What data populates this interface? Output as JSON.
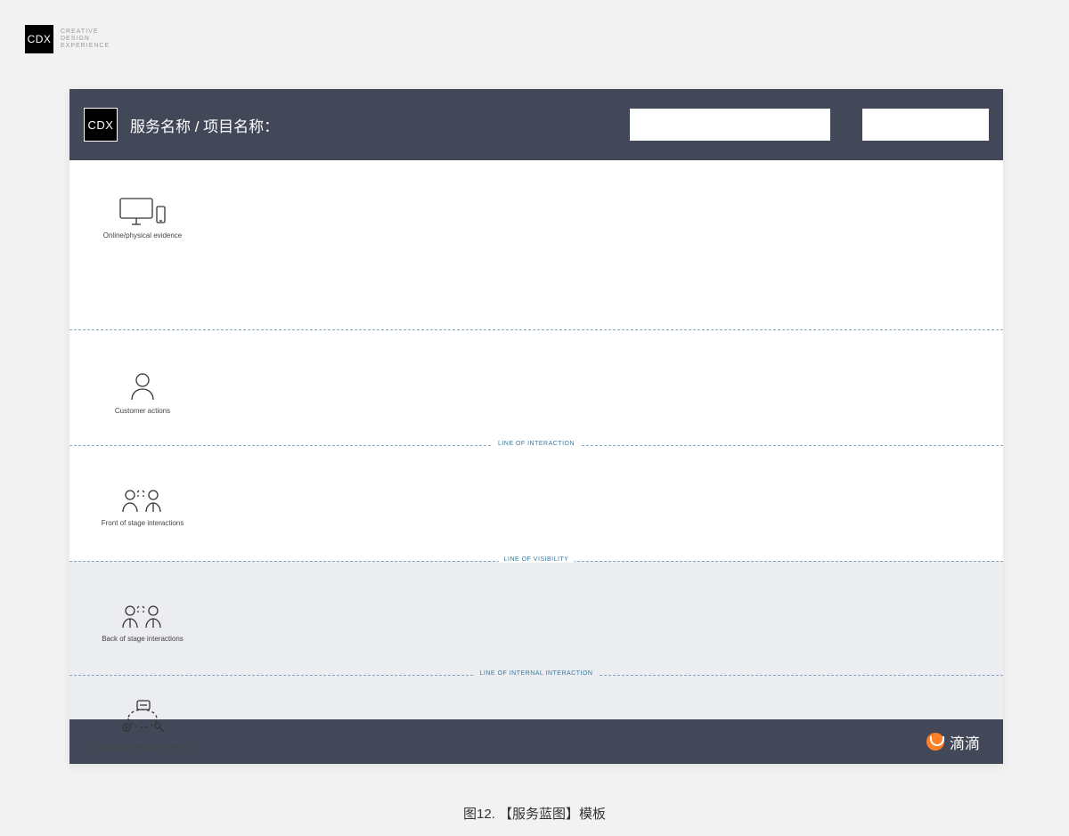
{
  "brand": {
    "badge": "CDX",
    "line1": "CREATIVE",
    "line2": "DESIGN",
    "line3": "EXPERIENCE"
  },
  "header": {
    "logo_text": "CDX",
    "title": "服务名称 / 项目名称："
  },
  "lanes": [
    {
      "label": "Online/physical evidence"
    },
    {
      "label": "Customer actions"
    },
    {
      "label": "Front of stage interactions"
    },
    {
      "label": "Back of stage interactions"
    },
    {
      "label": "Support processes & systems"
    }
  ],
  "dividers": {
    "d1": "",
    "d2": "LINE OF INTERACTION",
    "d3": "LINE OF VISIBILITY",
    "d4": "LINE OF INTERNAL INTERACTION"
  },
  "footer": {
    "brand": "滴滴"
  },
  "caption": "图12. 【服务蓝图】模板"
}
